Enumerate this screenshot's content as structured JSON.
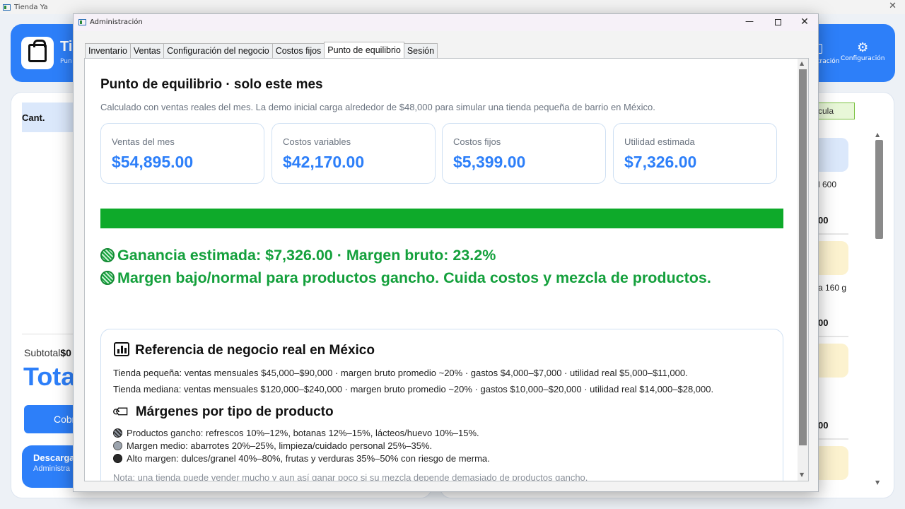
{
  "app": {
    "window_title": "Tienda Ya",
    "header_title": "Ti",
    "header_sub": "Pun",
    "nav_admin_label": "tración",
    "nav_config_label": "Configuración",
    "cant_header": "Cant.",
    "subtotal_label": "Subtotal",
    "subtotal_value": "$0",
    "total_label": "Tota",
    "cobrar_label": "Cobr",
    "descarga_title": "Descarga",
    "descarga_sub": "Administra",
    "calc_label": "cula",
    "products": [
      {
        "text": "l 600",
        "price": "00",
        "color": "#dbe8fb"
      },
      {
        "text": "a 160 g",
        "price": "00",
        "color": "#fcf2cf"
      },
      {
        "text": "",
        "price": "00",
        "color": "#fcf2cf"
      },
      {
        "text": "",
        "price": "",
        "color": "#fcf2cf"
      }
    ]
  },
  "dialog": {
    "title": "Administración",
    "tabs": [
      {
        "label": "Inventario",
        "active": false
      },
      {
        "label": "Ventas",
        "active": false
      },
      {
        "label": "Configuración del negocio",
        "active": false
      },
      {
        "label": "Costos fijos",
        "active": false
      },
      {
        "label": "Punto de equilibrio",
        "active": true
      },
      {
        "label": "Sesión",
        "active": false
      }
    ]
  },
  "breakeven": {
    "title": "Punto de equilibrio · solo este mes",
    "description": "Calculado con ventas reales del mes. La demo inicial carga alrededor de $48,000 para simular una tienda pequeña de barrio en México.",
    "kpis": [
      {
        "label": "Ventas del mes",
        "value": "$54,895.00"
      },
      {
        "label": "Costos variables",
        "value": "$42,170.00"
      },
      {
        "label": "Costos fijos",
        "value": "$5,399.00"
      },
      {
        "label": "Utilidad estimada",
        "value": "$7,326.00"
      }
    ],
    "progress_fraction": 1.0,
    "progress_color": "#0eaa2a",
    "result_line1": "Ganancia estimada: $7,326.00  ·  Margen bruto: 23.2%",
    "result_line2": "Margen bajo/normal para productos gancho. Cuida costos y mezcla de productos.",
    "result_color": "#14a03c"
  },
  "reference": {
    "heading": "Referencia de negocio real en México",
    "lines": [
      "Tienda pequeña: ventas mensuales $45,000–$90,000 · margen bruto promedio ~20% · gastos $4,000–$7,000 · utilidad real $5,000–$11,000.",
      "Tienda mediana: ventas mensuales $120,000–$240,000 · margen bruto promedio ~20% · gastos $10,000–$20,000 · utilidad real $14,000–$28,000."
    ],
    "margins_heading": "Márgenes por tipo de producto",
    "margins": [
      "Productos gancho: refrescos 10%–12%, botanas 12%–15%, lácteos/huevo 10%–15%.",
      "Margen medio: abarrotes 20%–25%, limpieza/cuidado personal 25%–35%.",
      "Alto margen: dulces/granel 40%–80%, frutas y verduras 35%–50% con riesgo de merma."
    ],
    "note": "Nota: una tienda puede vender mucho y aun así ganar poco si su mezcla depende demasiado de productos gancho."
  },
  "colors": {
    "accent": "#2d7ff9",
    "success": "#14a03c"
  }
}
